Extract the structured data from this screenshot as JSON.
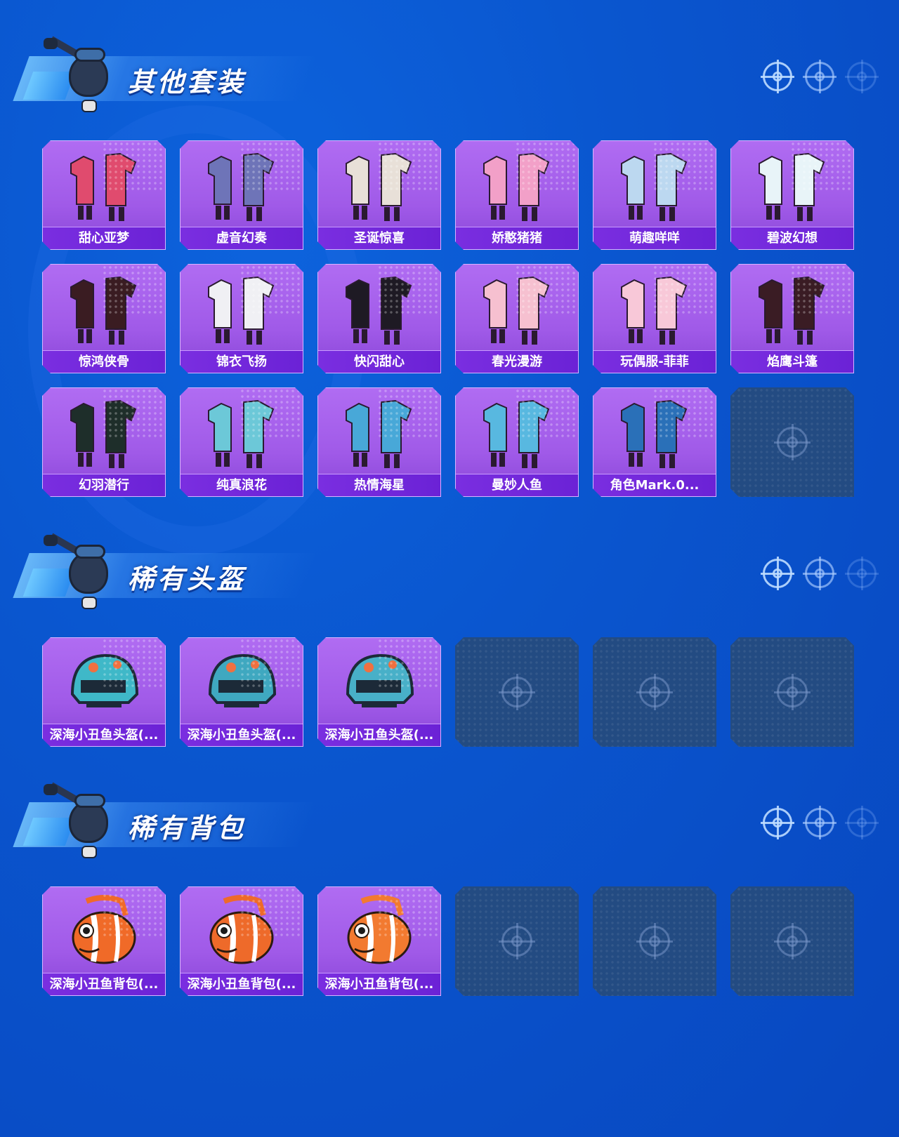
{
  "sections": [
    {
      "title": "其他套装",
      "items": [
        {
          "label": "甜心亚梦",
          "color": "#e04b6e",
          "icon": "outfit-icon"
        },
        {
          "label": "虚音幻奏",
          "color": "#6e74b8",
          "icon": "outfit-icon"
        },
        {
          "label": "圣诞惊喜",
          "color": "#e8e0d8",
          "icon": "outfit-icon"
        },
        {
          "label": "娇憨猪猪",
          "color": "#f2a0c8",
          "icon": "outfit-icon"
        },
        {
          "label": "萌趣咩咩",
          "color": "#bcd8f0",
          "icon": "outfit-icon"
        },
        {
          "label": "碧波幻想",
          "color": "#e8f4f8",
          "icon": "outfit-icon"
        },
        {
          "label": "惊鸿侠骨",
          "color": "#3a1c22",
          "icon": "outfit-icon"
        },
        {
          "label": "锦衣飞扬",
          "color": "#f0f0f4",
          "icon": "outfit-icon"
        },
        {
          "label": "快闪甜心",
          "color": "#1e1a24",
          "icon": "outfit-icon"
        },
        {
          "label": "春光漫游",
          "color": "#f6c0d0",
          "icon": "outfit-icon"
        },
        {
          "label": "玩偶服-菲菲",
          "color": "#f8c8d8",
          "icon": "outfit-icon"
        },
        {
          "label": "焰鹰斗篷",
          "color": "#3a1c24",
          "icon": "outfit-icon"
        },
        {
          "label": "幻羽潜行",
          "color": "#1e2e2a",
          "icon": "outfit-icon"
        },
        {
          "label": "纯真浪花",
          "color": "#6cc8d8",
          "icon": "outfit-icon"
        },
        {
          "label": "热情海星",
          "color": "#48a8d8",
          "icon": "outfit-icon"
        },
        {
          "label": "曼妙人鱼",
          "color": "#58b8e0",
          "icon": "outfit-icon"
        },
        {
          "label": "角色Mark.0...",
          "color": "#2a70b8",
          "icon": "outfit-icon"
        }
      ],
      "empty_slots": 1
    },
    {
      "title": "稀有头盔",
      "items": [
        {
          "label": "深海小丑鱼头盔(...",
          "color": "#3fb8c8",
          "icon": "helmet-icon"
        },
        {
          "label": "深海小丑鱼头盔(...",
          "color": "#3fa8c0",
          "icon": "helmet-icon"
        },
        {
          "label": "深海小丑鱼头盔(...",
          "color": "#48b0c8",
          "icon": "helmet-icon"
        }
      ],
      "empty_slots": 3
    },
    {
      "title": "稀有背包",
      "items": [
        {
          "label": "深海小丑鱼背包(...",
          "color": "#f06a28",
          "icon": "backpack-icon"
        },
        {
          "label": "深海小丑鱼背包(...",
          "color": "#ee6a2a",
          "icon": "backpack-icon"
        },
        {
          "label": "深海小丑鱼背包(...",
          "color": "#f27a30",
          "icon": "backpack-icon"
        }
      ],
      "empty_slots": 3
    }
  ],
  "colors": {
    "background": "#0a56cf",
    "card": "#a05ae8",
    "label_bar": "#7a2ee0",
    "empty_slot": "#234b82"
  }
}
